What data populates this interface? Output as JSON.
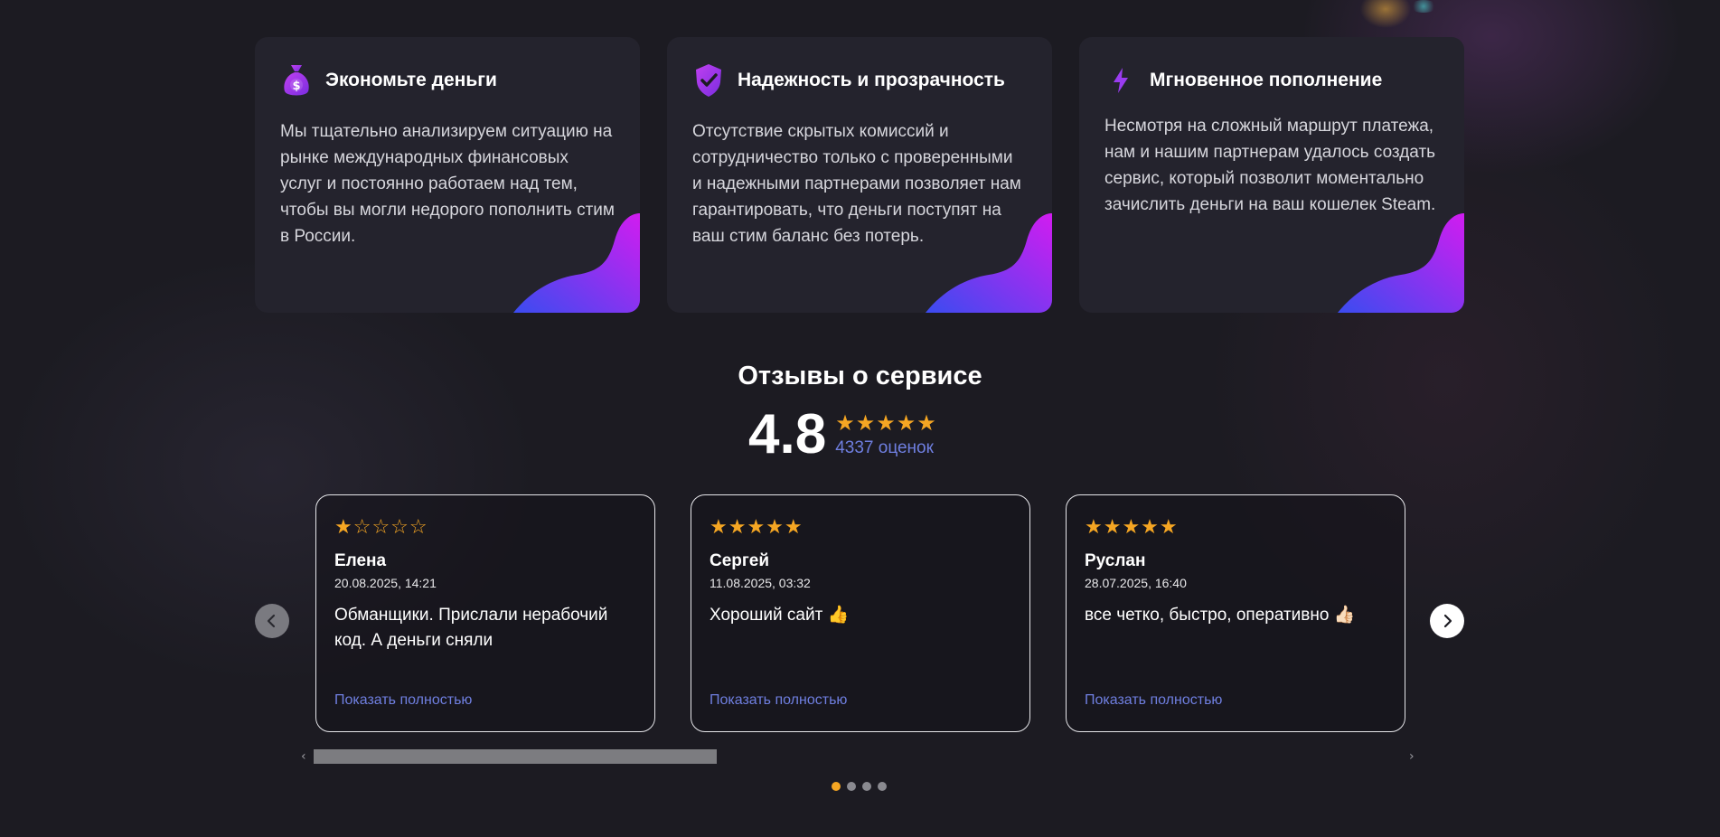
{
  "features": [
    {
      "icon": "money-bag-icon",
      "title": "Экономьте деньги",
      "text": "Мы тщательно анализируем ситуацию на рынке международных финансовых услуг и постоянно работаем над тем, чтобы вы могли недорого пополнить стим в России."
    },
    {
      "icon": "shield-check-icon",
      "title": "Надежность и прозрачность",
      "text": "Отсутствие скрытых комиссий и сотрудничество только с проверенными и надежными партнерами позволяет нам гарантировать, что деньги поступят на ваш стим баланс без потерь."
    },
    {
      "icon": "lightning-icon",
      "title": "Мгновенное пополнение",
      "text": "Несмотря на сложный маршрут платежа, нам и нашим партнерам удалось создать сервис, который позволит моментально зачислить деньги на ваш кошелек Steam."
    }
  ],
  "reviews_section": {
    "title": "Отзывы о сервисе",
    "rating_value": "4.8",
    "rating_stars": "★★★★★",
    "rating_count": "4337 оценок"
  },
  "reviews": [
    {
      "stars": "★☆☆☆☆",
      "rating": 1,
      "name": "Елена",
      "date": "20.08.2025, 14:21",
      "text": "Обманщики. Прислали нерабочий код. А деньги сняли",
      "more_label": "Показать полностью"
    },
    {
      "stars": "★★★★★",
      "rating": 5,
      "name": "Сергей",
      "date": "11.08.2025, 03:32",
      "text": "Хороший сайт 👍",
      "more_label": "Показать полностью"
    },
    {
      "stars": "★★★★★",
      "rating": 5,
      "name": "Руслан",
      "date": "28.07.2025, 16:40",
      "text": "все четко, быстро, оперативно 👍🏻",
      "more_label": "Показать полностью"
    }
  ],
  "carousel": {
    "prev_icon": "chevron-left-icon",
    "next_icon": "chevron-right-icon",
    "scroll_fraction": 0.37,
    "dots": 4,
    "active_dot": 0
  },
  "colors": {
    "accent_star": "#f5a623",
    "link": "#6f7fe0",
    "gradient_start": "#3a4cf0",
    "gradient_end": "#d21cf0",
    "card_bg": "#24232d"
  }
}
